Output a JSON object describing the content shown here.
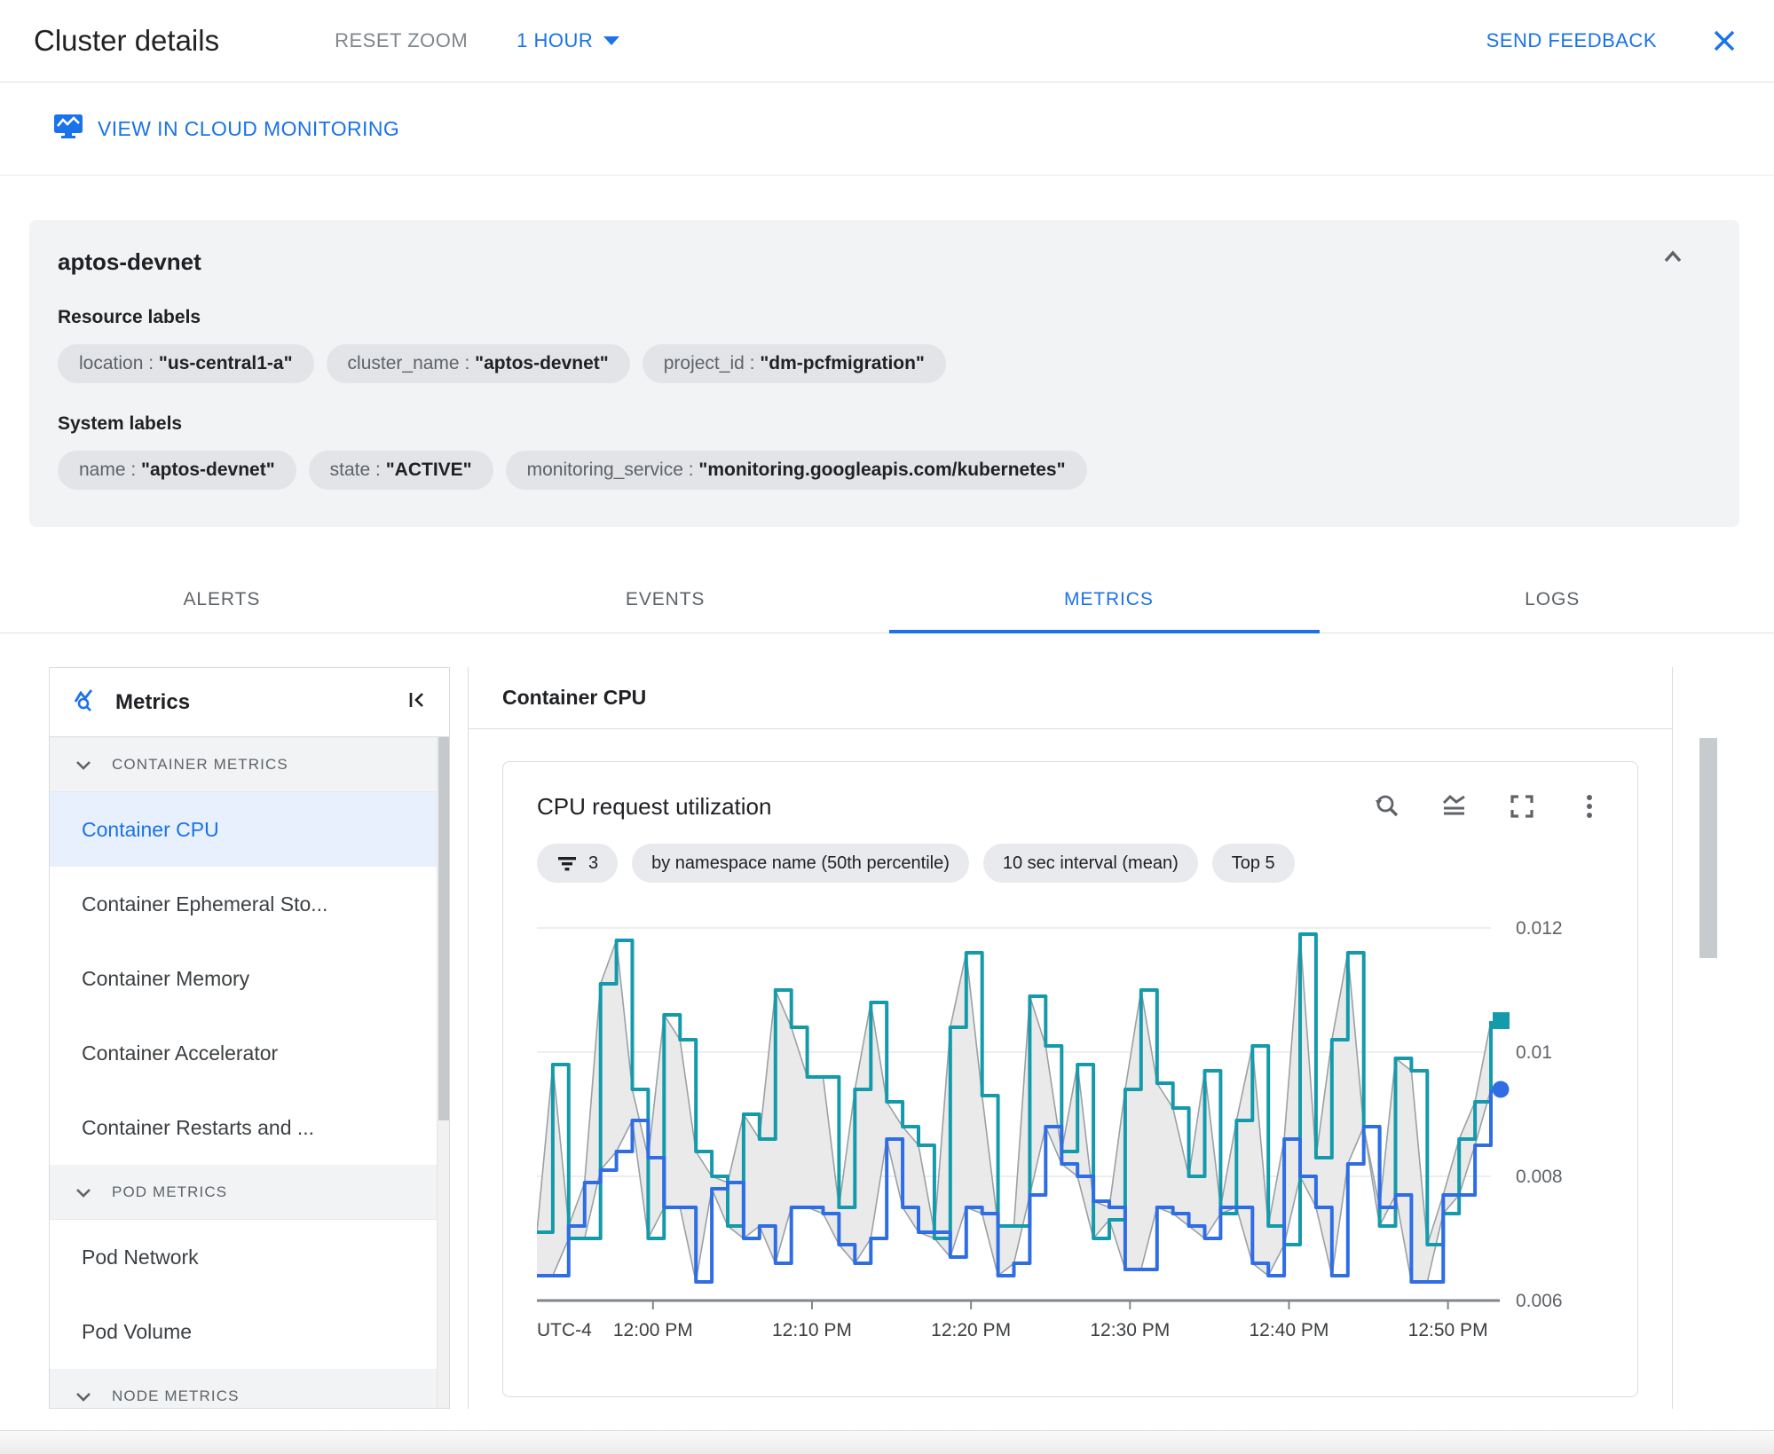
{
  "header": {
    "title": "Cluster details",
    "reset_zoom_label": "RESET ZOOM",
    "time_range_label": "1 HOUR",
    "send_feedback_label": "SEND FEEDBACK"
  },
  "link_row": {
    "view_in_monitoring_label": "VIEW IN CLOUD MONITORING"
  },
  "summary": {
    "cluster_name": "aptos-devnet",
    "resource_labels_title": "Resource labels",
    "resource_labels": [
      {
        "key": "location",
        "value": "\"us-central1-a\""
      },
      {
        "key": "cluster_name",
        "value": "\"aptos-devnet\""
      },
      {
        "key": "project_id",
        "value": "\"dm-pcfmigration\""
      }
    ],
    "system_labels_title": "System labels",
    "system_labels": [
      {
        "key": "name",
        "value": "\"aptos-devnet\""
      },
      {
        "key": "state",
        "value": "\"ACTIVE\""
      },
      {
        "key": "monitoring_service",
        "value": "\"monitoring.googleapis.com/kubernetes\""
      }
    ]
  },
  "tabs": [
    {
      "label": "ALERTS"
    },
    {
      "label": "EVENTS"
    },
    {
      "label": "METRICS"
    },
    {
      "label": "LOGS"
    }
  ],
  "sidebar": {
    "title": "Metrics",
    "sections": [
      {
        "header": "CONTAINER METRICS",
        "items": [
          {
            "label": "Container CPU",
            "selected": true
          },
          {
            "label": "Container Ephemeral Sto..."
          },
          {
            "label": "Container Memory"
          },
          {
            "label": "Container Accelerator"
          },
          {
            "label": "Container Restarts and ..."
          }
        ]
      },
      {
        "header": "POD METRICS",
        "items": [
          {
            "label": "Pod Network"
          },
          {
            "label": "Pod Volume"
          }
        ]
      },
      {
        "header": "NODE METRICS",
        "items": []
      }
    ]
  },
  "main": {
    "header": "Container CPU"
  },
  "chart_data": {
    "type": "line",
    "title": "CPU request utilization",
    "filters": {
      "filter_count": "3",
      "group_by": "by namespace name (50th percentile)",
      "interval": "10 sec interval (mean)",
      "top": "Top 5"
    },
    "x_axis": {
      "timezone_label": "UTC-4",
      "range_minutes": [
        0,
        60
      ],
      "ticks": [
        {
          "label": "12:00 PM",
          "minute": 7.3
        },
        {
          "label": "12:10 PM",
          "minute": 17.3
        },
        {
          "label": "12:20 PM",
          "minute": 27.3
        },
        {
          "label": "12:30 PM",
          "minute": 37.3
        },
        {
          "label": "12:40 PM",
          "minute": 47.3
        },
        {
          "label": "12:50 PM",
          "minute": 57.3
        }
      ]
    },
    "y_axis": {
      "ylim": [
        0.006,
        0.0123
      ],
      "ticks": [
        {
          "label": "0.012",
          "value": 0.012,
          "gridline": true
        },
        {
          "label": "0.01",
          "value": 0.01,
          "gridline": true
        },
        {
          "label": "0.008",
          "value": 0.008,
          "gridline": true
        },
        {
          "label": "0.006",
          "value": 0.006,
          "gridline": false
        }
      ]
    },
    "series": [
      {
        "name": "series-1",
        "color": "#149aaa",
        "marker": "square",
        "interpolation": "step-after",
        "values": [
          0.0071,
          0.0098,
          0.007,
          0.007,
          0.0111,
          0.0118,
          0.0094,
          0.007,
          0.0106,
          0.0102,
          0.0084,
          0.008,
          0.0072,
          0.009,
          0.0086,
          0.011,
          0.0104,
          0.0096,
          0.0096,
          0.0075,
          0.0094,
          0.0108,
          0.0092,
          0.0088,
          0.0085,
          0.007,
          0.0104,
          0.0116,
          0.0093,
          0.0072,
          0.0072,
          0.0109,
          0.0101,
          0.0084,
          0.0098,
          0.007,
          0.0073,
          0.0094,
          0.011,
          0.0095,
          0.0091,
          0.008,
          0.0097,
          0.0074,
          0.0089,
          0.0101,
          0.0072,
          0.0069,
          0.0119,
          0.0083,
          0.0102,
          0.0116,
          0.0088,
          0.0072,
          0.0099,
          0.0097,
          0.0069,
          0.0074,
          0.0086,
          0.0092,
          0.0105
        ]
      },
      {
        "name": "series-2",
        "color": "#2f6de4",
        "marker": "circle",
        "interpolation": "step-after",
        "values": [
          0.0064,
          0.0064,
          0.0072,
          0.0079,
          0.0081,
          0.0084,
          0.0089,
          0.0083,
          0.0075,
          0.0075,
          0.0063,
          0.0078,
          0.0079,
          0.007,
          0.0072,
          0.0066,
          0.0075,
          0.0075,
          0.0074,
          0.0069,
          0.0066,
          0.007,
          0.0086,
          0.0075,
          0.0071,
          0.0071,
          0.0067,
          0.0075,
          0.0074,
          0.0064,
          0.0066,
          0.0077,
          0.0088,
          0.0082,
          0.008,
          0.0076,
          0.0075,
          0.0065,
          0.0065,
          0.0075,
          0.0074,
          0.0072,
          0.007,
          0.0075,
          0.0075,
          0.0066,
          0.0064,
          0.0086,
          0.008,
          0.0075,
          0.0064,
          0.0082,
          0.0088,
          0.0075,
          0.0077,
          0.0063,
          0.0063,
          0.0077,
          0.0077,
          0.0085,
          0.0094
        ]
      }
    ],
    "band": {
      "description": "min-max envelope of plotted series",
      "fill": "#e8e8e8",
      "stroke": "#9aa0a6",
      "interpolation": "linear"
    }
  },
  "colors": {
    "accent_blue": "#1a73e8",
    "icon_gray": "#5f6368",
    "axis_gray": "#80868b",
    "gridline": "#e3e3e3",
    "selected_item_bg": "#e8f0fe"
  }
}
